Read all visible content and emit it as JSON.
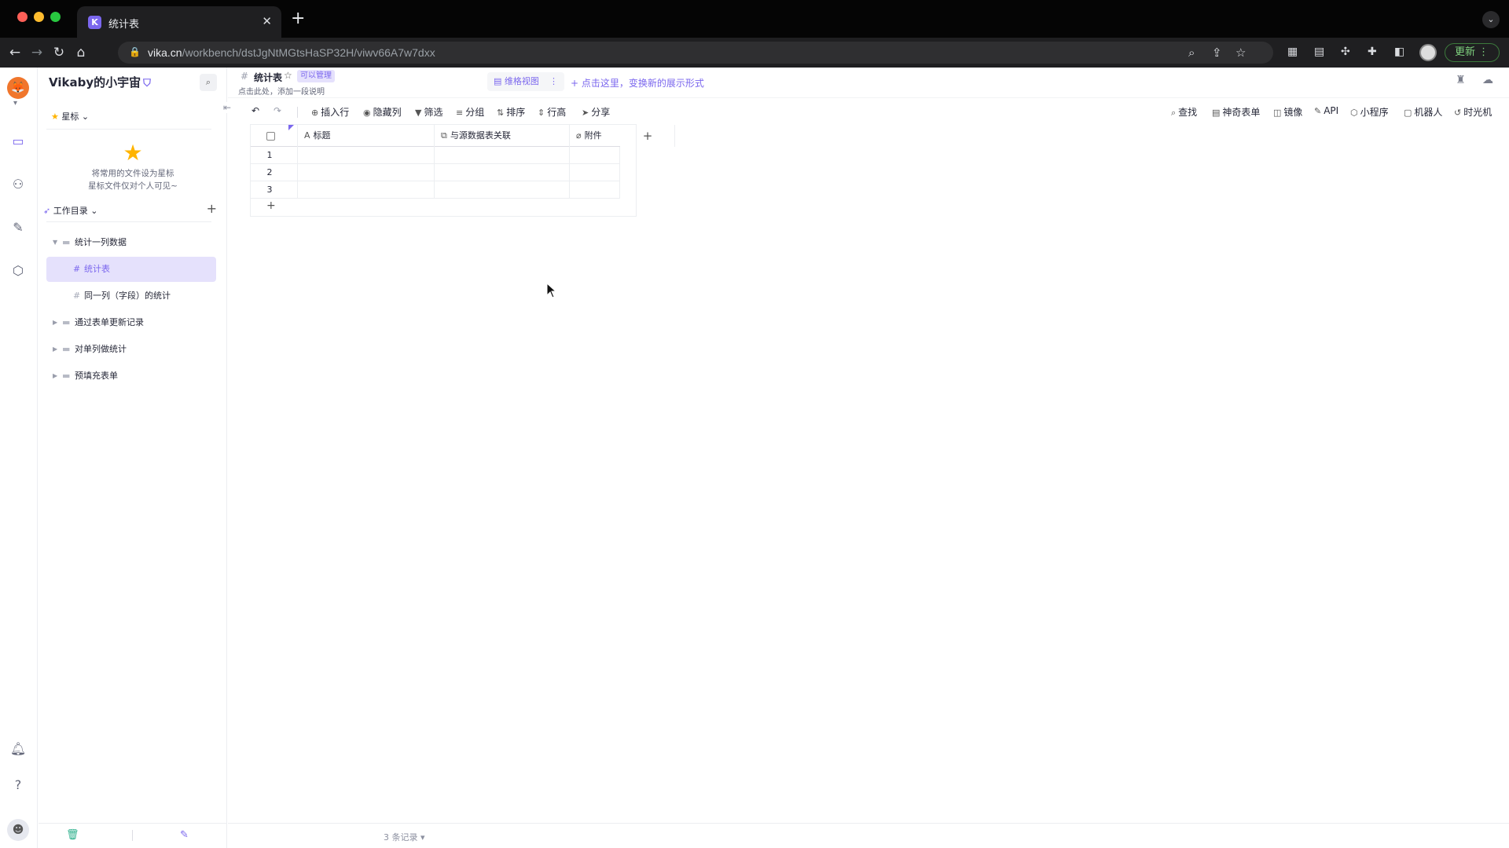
{
  "browser": {
    "tab_title": "统计表",
    "favicon_letter": "K",
    "url_host": "vika.cn",
    "url_path": "/workbench/dstJgNtMGtsHaSP32H/viwv66A7w7dxx",
    "update_label": "更新"
  },
  "rail": {
    "items": [
      {
        "icon": "workbench-icon",
        "active": true
      },
      {
        "icon": "members-icon",
        "active": false
      },
      {
        "icon": "template-icon",
        "active": false
      },
      {
        "icon": "settings-icon",
        "active": false
      }
    ],
    "bottom": [
      {
        "icon": "bell-icon"
      },
      {
        "icon": "help-icon"
      }
    ]
  },
  "sidebar": {
    "space_name": "Vikaby的小宇宙",
    "star_label": "星标",
    "empty_star_line1": "将常用的文件设为星标",
    "empty_star_line2": "星标文件仅对个人可见~",
    "catalog_label": "工作目录",
    "tree": [
      {
        "label": "统计一列数据",
        "type": "folder",
        "expanded": true
      },
      {
        "label": "统计表",
        "type": "datasheet",
        "selected": true
      },
      {
        "label": "同一列（字段）的统计",
        "type": "datasheet"
      },
      {
        "label": "通过表单更新记录",
        "type": "folder"
      },
      {
        "label": "对单列做统计",
        "type": "folder"
      },
      {
        "label": "预填充表单",
        "type": "folder"
      }
    ]
  },
  "datasheet": {
    "title": "统计表",
    "permission": "可以管理",
    "description": "点击此处，添加一段说明",
    "view_name": "维格视图",
    "view_hint": "点击这里，变换新的展示形式"
  },
  "toolbar": {
    "left": [
      "插入行",
      "隐藏列",
      "筛选",
      "分组",
      "排序",
      "行高",
      "分享"
    ],
    "right": [
      "查找",
      "神奇表单",
      "镜像",
      "API",
      "小程序",
      "机器人",
      "时光机"
    ]
  },
  "grid": {
    "columns": [
      {
        "name": "标题",
        "icon": "text-field-icon"
      },
      {
        "name": "与源数据表关联",
        "icon": "link-field-icon"
      },
      {
        "name": "附件",
        "icon": "attachment-field-icon"
      }
    ],
    "rows": [
      "1",
      "2",
      "3"
    ]
  },
  "status": {
    "record_count": "3 条记录"
  }
}
